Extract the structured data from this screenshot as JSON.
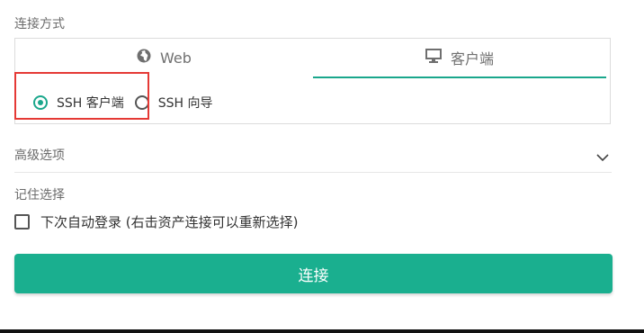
{
  "connection": {
    "label": "连接方式",
    "tabs": [
      {
        "label": "Web",
        "icon": "globe-icon",
        "active": false
      },
      {
        "label": "客户端",
        "icon": "monitor-icon",
        "active": true
      }
    ],
    "options": [
      {
        "label": "SSH 客户端",
        "checked": true
      },
      {
        "label": "SSH 向导",
        "checked": false
      }
    ]
  },
  "advanced": {
    "label": "高级选项",
    "icon": "chevron-down-icon"
  },
  "remember": {
    "label": "记住选择",
    "checkbox_label": "下次自动登录 (右击资产连接可以重新选择)",
    "checked": false
  },
  "connect_button": {
    "label": "连接"
  },
  "colors": {
    "accent": "#1aaf8f",
    "highlight": "#e53935"
  }
}
